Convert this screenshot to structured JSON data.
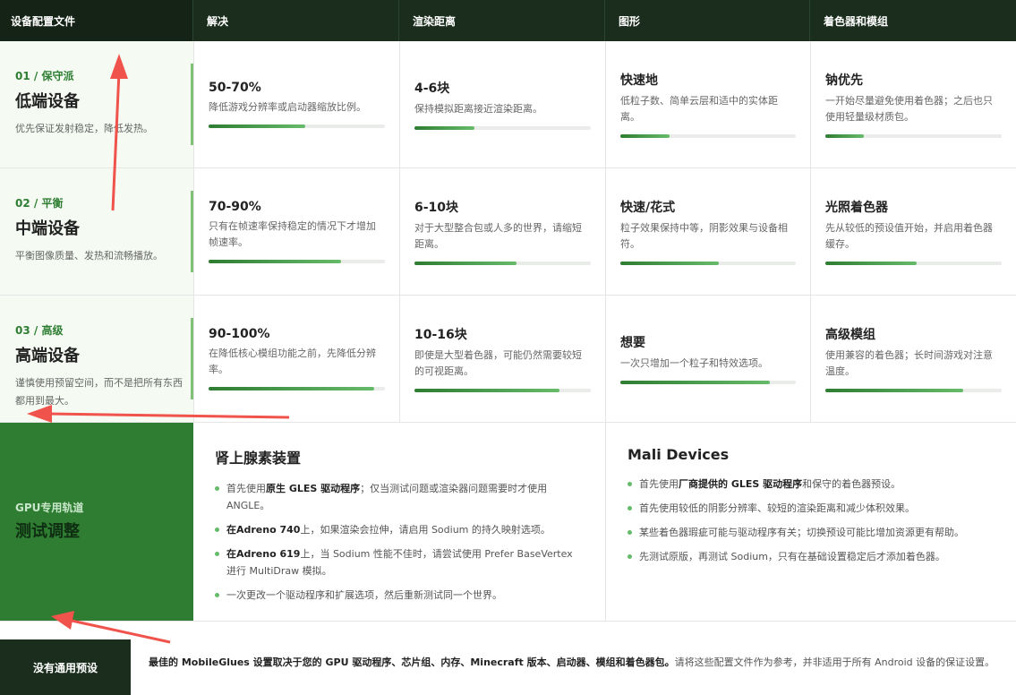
{
  "header": [
    "设备配置文件",
    "解决",
    "渲染距离",
    "图形",
    "着色器和模组"
  ],
  "rows": [
    {
      "tier": "01 / 保守派",
      "name": "低端设备",
      "desc": "优先保证发射稳定，降低发热。",
      "cells": [
        {
          "v": "50-70%",
          "d": "降低游戏分辨率或启动器缩放比例。",
          "p": 0.55
        },
        {
          "v": "4-6块",
          "d": "保持模拟距离接近渲染距离。",
          "p": 0.34
        },
        {
          "v": "快速地",
          "d": "低粒子数、简单云层和适中的实体距离。",
          "p": 0.28
        },
        {
          "v": "钠优先",
          "d": "一开始尽量避免使用着色器；之后也只使用轻量级材质包。",
          "p": 0.22
        }
      ]
    },
    {
      "tier": "02 / 平衡",
      "name": "中端设备",
      "desc": "平衡图像质量、发热和流畅播放。",
      "cells": [
        {
          "v": "70-90%",
          "d": "只有在帧速率保持稳定的情况下才增加帧速率。",
          "p": 0.75
        },
        {
          "v": "6-10块",
          "d": "对于大型整合包或人多的世界，请缩短距离。",
          "p": 0.58
        },
        {
          "v": "快速/花式",
          "d": "粒子效果保持中等，阴影效果与设备相符。",
          "p": 0.56
        },
        {
          "v": "光照着色器",
          "d": "先从较低的预设值开始，并启用着色器缓存。",
          "p": 0.52
        }
      ]
    },
    {
      "tier": "03 / 高级",
      "name": "高端设备",
      "desc": "谨慎使用预留空间，而不是把所有东西都用到最大。",
      "cells": [
        {
          "v": "90-100%",
          "d": "在降低核心模组功能之前，先降低分辨率。",
          "p": 0.94
        },
        {
          "v": "10-16块",
          "d": "即使是大型着色器，可能仍然需要较短的可视距离。",
          "p": 0.82
        },
        {
          "v": "想要",
          "d": "一次只增加一个粒子和特效选项。",
          "p": 0.85
        },
        {
          "v": "高级模组",
          "d": "使用兼容的着色器；长时间游戏对注意温度。",
          "p": 0.78
        }
      ]
    }
  ],
  "gpu": {
    "kicker": "GPU专用轨道",
    "title": "测试调整",
    "col1": {
      "title": "肾上腺素装置",
      "items": [
        [
          "首先使用",
          "原生 GLES 驱动程序",
          "；仅当测试问题或渲染器问题需要时才使用 ANGLE。"
        ],
        [
          "",
          "在Adreno 740",
          "上，如果渲染会拉伸，请启用 Sodium 的持久映射选项。"
        ],
        [
          "",
          "在Adreno 619",
          "上，当 Sodium 性能不佳时，请尝试使用 Prefer BaseVertex 进行 MultiDraw 模拟。"
        ],
        [
          "一次更改一个驱动程序和扩展选项，然后重新测试同一个世界。",
          "",
          ""
        ]
      ]
    },
    "col2": {
      "title": "Mali Devices",
      "items": [
        [
          "首先使用",
          "厂商提供的 GLES 驱动程序",
          "和保守的着色器预设。"
        ],
        [
          "首先使用较低的阴影分辨率、较短的渲染距离和减少体积效果。",
          "",
          ""
        ],
        [
          "某些着色器瑕疵可能与驱动程序有关；切换预设可能比增加资源更有帮助。",
          "",
          ""
        ],
        [
          "先测试原版，再测试 Sodium，只有在基础设置稳定后才添加着色器。",
          "",
          ""
        ]
      ]
    }
  },
  "footer": {
    "label": "没有通用预设",
    "bold": "最佳的 MobileGlues 设置取决于您的 GPU 驱动程序、芯片组、内存、Minecraft 版本、启动器、模组和着色器包。",
    "text": "请将这些配置文件作为参考，并非适用于所有 Android 设备的保证设置。"
  },
  "colors": {
    "accent": "#2e7d32",
    "dark": "#1b2e1d",
    "arrow": "#f0534b"
  }
}
